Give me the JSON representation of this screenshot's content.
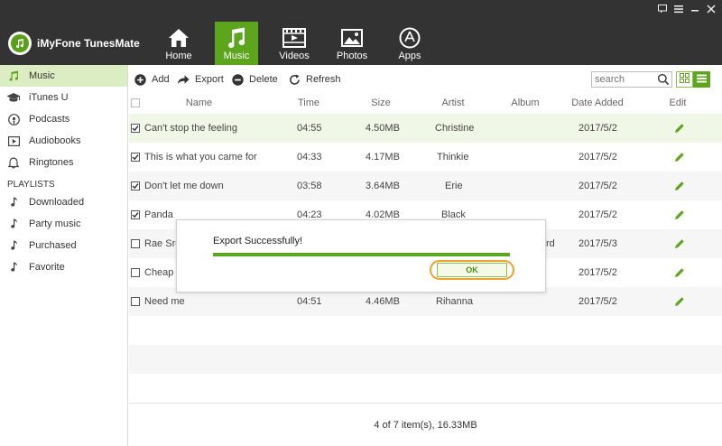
{
  "app": {
    "title": "iMyFone TunesMate"
  },
  "nav": {
    "tabs": [
      {
        "label": "Home",
        "icon": "home-icon"
      },
      {
        "label": "Music",
        "icon": "music-note-icon"
      },
      {
        "label": "Videos",
        "icon": "film-icon"
      },
      {
        "label": "Photos",
        "icon": "picture-icon"
      },
      {
        "label": "Apps",
        "icon": "app-store-icon"
      }
    ],
    "active": "Music"
  },
  "sidebar": {
    "items": [
      {
        "label": "Music",
        "icon": "music-note-icon"
      },
      {
        "label": "iTunes U",
        "icon": "graduation-cap-icon"
      },
      {
        "label": "Podcasts",
        "icon": "podcast-icon"
      },
      {
        "label": "Audiobooks",
        "icon": "audiobook-icon"
      },
      {
        "label": "Ringtones",
        "icon": "bell-icon"
      }
    ],
    "playlists_header": "PLAYLISTS",
    "playlists": [
      {
        "label": "Downloaded"
      },
      {
        "label": "Party music"
      },
      {
        "label": "Purchased"
      },
      {
        "label": "Favorite"
      }
    ]
  },
  "toolbar": {
    "add_label": "Add",
    "export_label": "Export",
    "delete_label": "Delete",
    "refresh_label": "Refresh",
    "search_placeholder": "search"
  },
  "table": {
    "headers": {
      "name": "Name",
      "time": "Time",
      "size": "Size",
      "artist": "Artist",
      "album": "Album",
      "date_added": "Date Added",
      "edit": "Edit"
    },
    "rows": [
      {
        "name": "Can't stop the feeling",
        "time": "04:55",
        "size": "4.50MB",
        "artist": "Christine",
        "album": "",
        "date": "2017/5/2",
        "checked": true
      },
      {
        "name": "This is what you came for",
        "time": "04:33",
        "size": "4.17MB",
        "artist": "Thinkie",
        "album": "",
        "date": "2017/5/2",
        "checked": true
      },
      {
        "name": "Don't let me down",
        "time": "03:58",
        "size": "3.64MB",
        "artist": "Erie",
        "album": "",
        "date": "2017/5/2",
        "checked": true
      },
      {
        "name": "Panda",
        "time": "04:23",
        "size": "4.02MB",
        "artist": "Black",
        "album": "",
        "date": "2017/5/2",
        "checked": true
      },
      {
        "name": "Rae Sre",
        "time": "",
        "size": "",
        "artist": "",
        "album": "rd",
        "date": "2017/5/3",
        "checked": false
      },
      {
        "name": "Cheap T",
        "time": "",
        "size": "",
        "artist": "",
        "album": "",
        "date": "2017/5/2",
        "checked": false
      },
      {
        "name": "Need me",
        "time": "04:51",
        "size": "4.46MB",
        "artist": "Rihanna",
        "album": "",
        "date": "2017/5/2",
        "checked": false
      }
    ]
  },
  "status": {
    "text": "4 of 7 item(s), 16.33MB"
  },
  "dialog": {
    "message": "Export Successfully!",
    "ok_label": "OK",
    "progress": 1.0
  },
  "colors": {
    "accent": "#5da51d",
    "titlebar": "#333333",
    "highlight": "#f0a030"
  }
}
